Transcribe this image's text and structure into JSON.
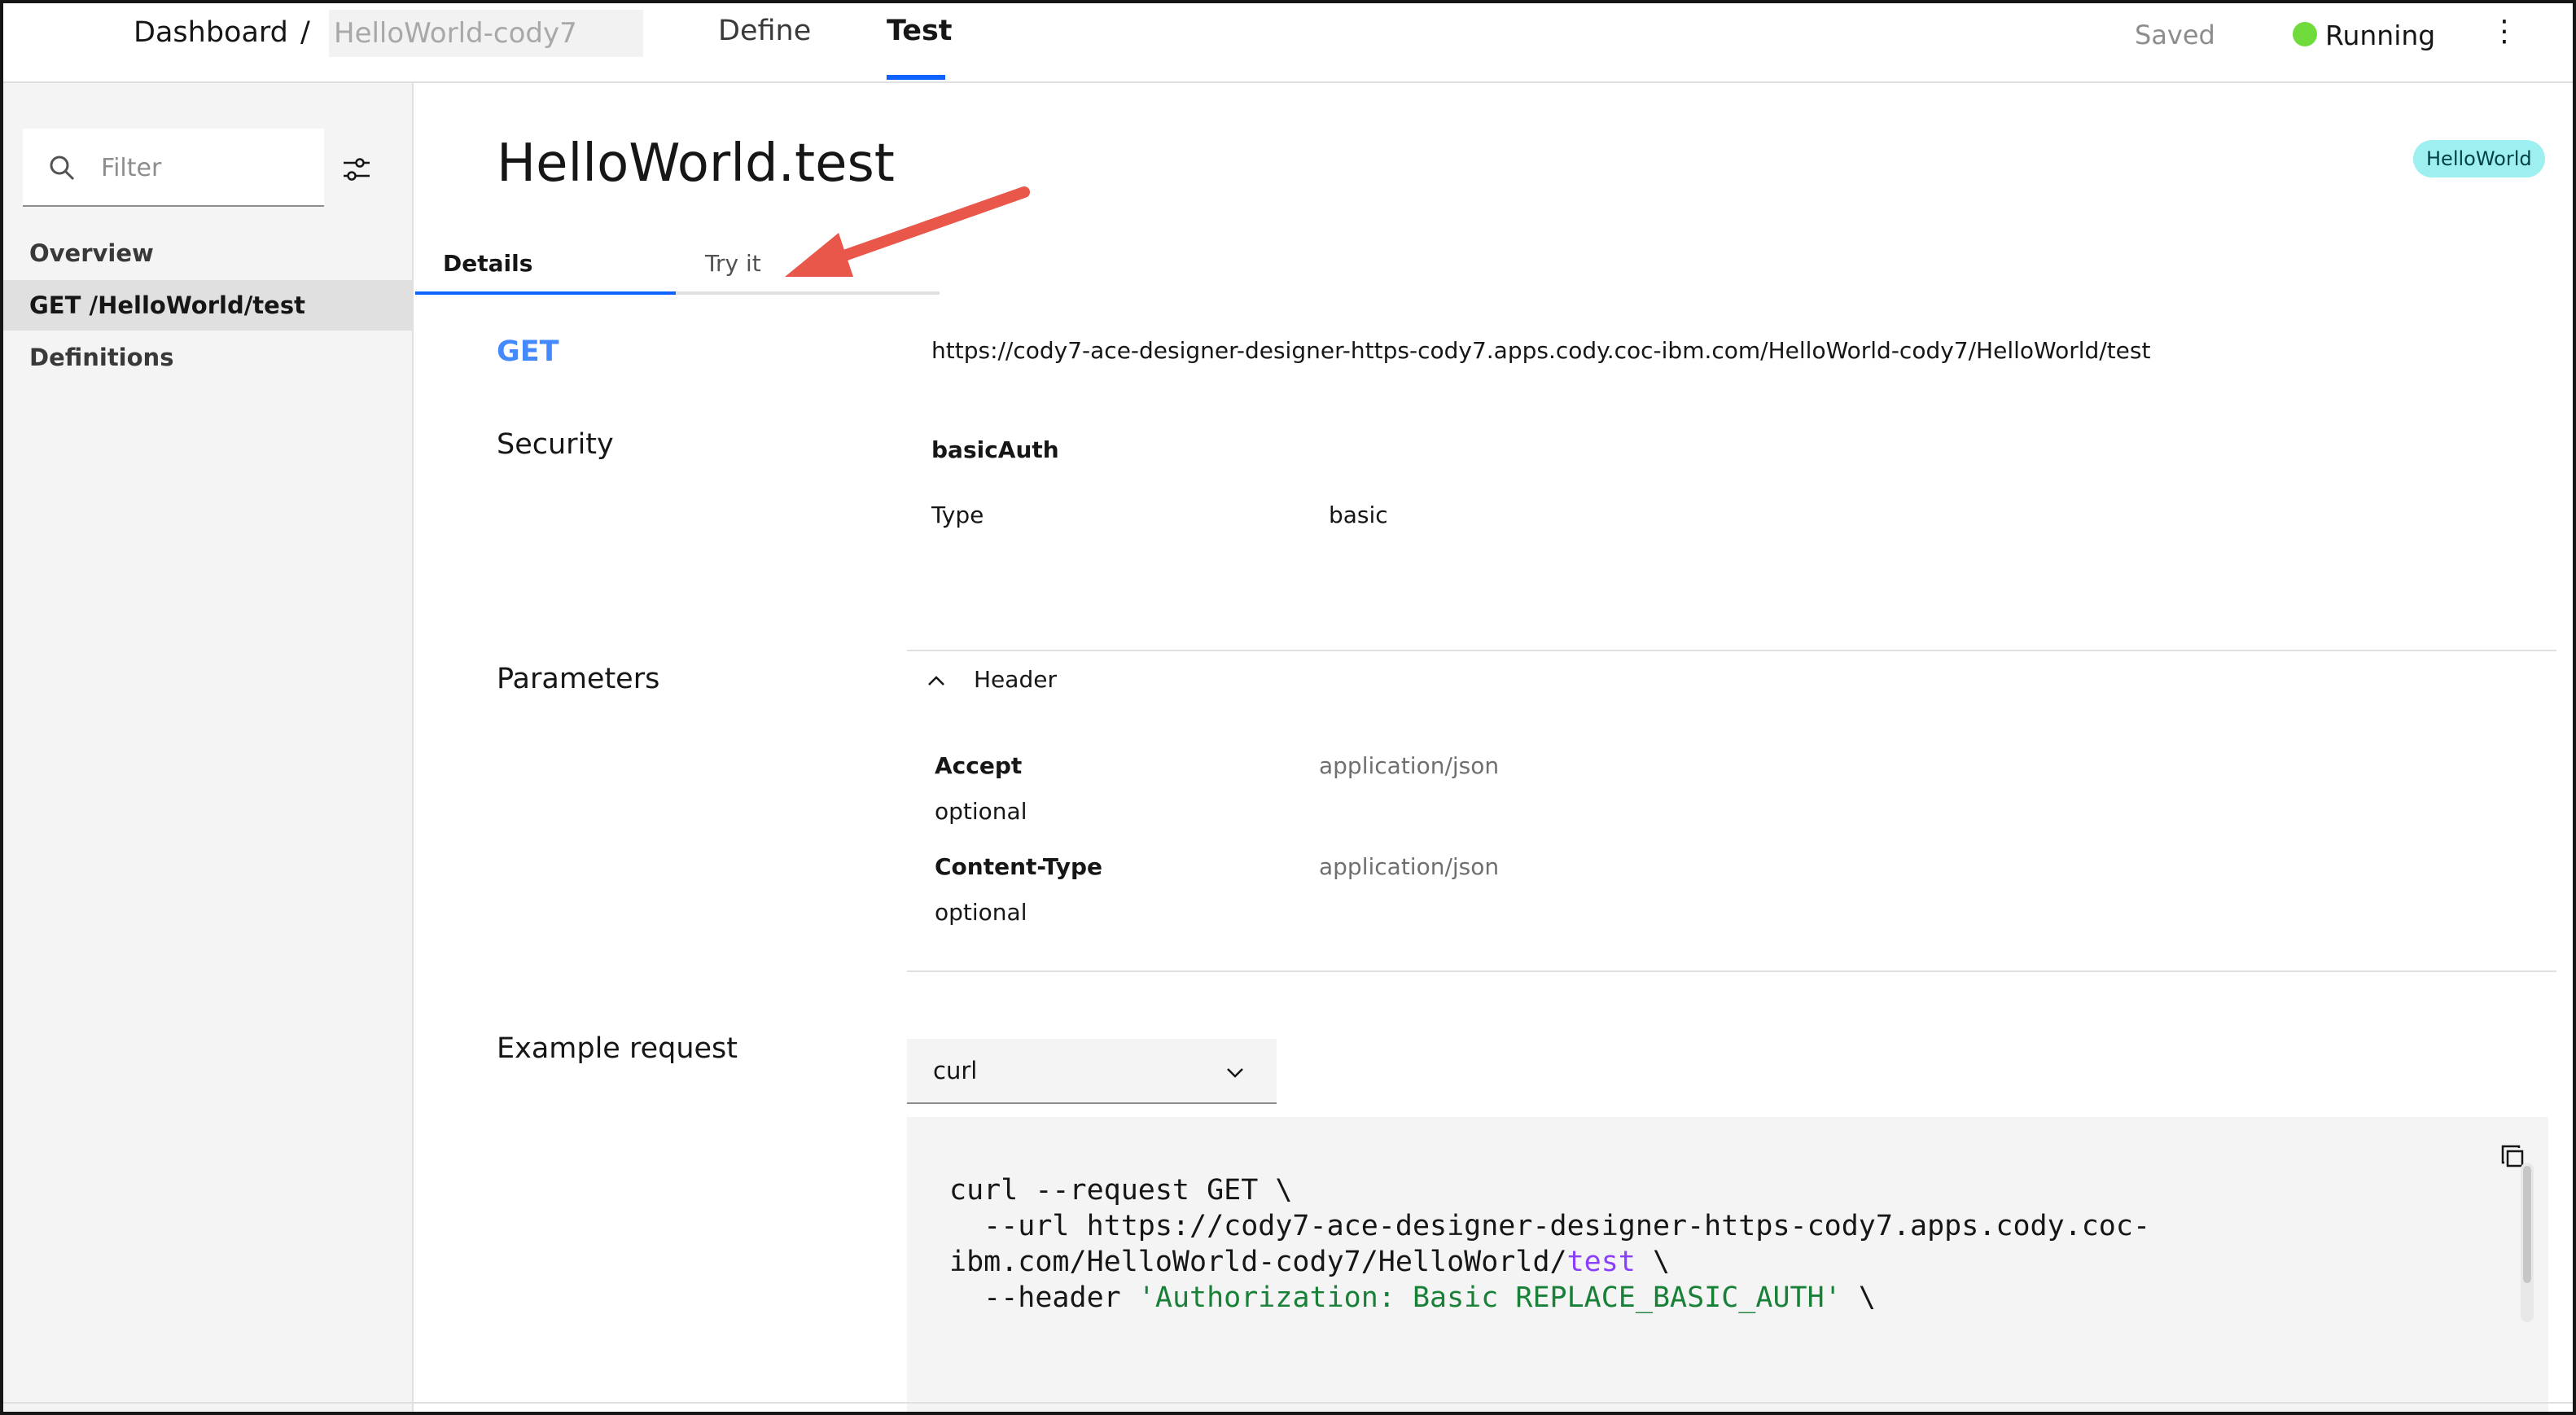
{
  "breadcrumb": {
    "dashboard_label": "Dashboard",
    "separator": "/",
    "flow_name_placeholder": "HelloWorld-cody7"
  },
  "top_tabs": {
    "define_label": "Define",
    "test_label": "Test",
    "active": "Test"
  },
  "status": {
    "saved_label": "Saved",
    "running_label": "Running",
    "running_color": "#6fdc3c",
    "overflow_icon": "⋮"
  },
  "sidebar": {
    "filter_placeholder": "Filter",
    "items": [
      {
        "label": "Overview"
      },
      {
        "label": "GET /HelloWorld/test",
        "selected": true
      },
      {
        "label": "Definitions"
      }
    ]
  },
  "main": {
    "title": "HelloWorld.test",
    "tag": "HelloWorld",
    "tabs": [
      {
        "label": "Details",
        "active": true
      },
      {
        "label": "Try it"
      }
    ],
    "method": "GET",
    "url": "https://cody7-ace-designer-designer-https-cody7.apps.cody.coc-ibm.com/HelloWorld-cody7/HelloWorld/test",
    "security": {
      "label": "Security",
      "scheme_name": "basicAuth",
      "type_key": "Type",
      "type_value": "basic"
    },
    "parameters": {
      "label": "Parameters",
      "group_label": "Header",
      "items": [
        {
          "name": "Accept",
          "required": "optional",
          "value": "application/json"
        },
        {
          "name": "Content-Type",
          "required": "optional",
          "value": "application/json"
        }
      ]
    },
    "example_request": {
      "label": "Example request",
      "language": "curl",
      "code_lines": [
        "curl --request GET \\",
        "  --url https://cody7-ace-designer-designer-https-cody7.apps.cody.coc-",
        "ibm.com/HelloWorld-cody7/HelloWorld/",
        "test",
        " \\",
        "  --header ",
        "'Authorization: Basic REPLACE_BASIC_AUTH'",
        " \\"
      ]
    }
  },
  "colors": {
    "accent": "#0f62fe",
    "method_get": "#4589ff",
    "tag_bg": "#9ef0f0",
    "annotation_arrow": "#e8574a"
  }
}
